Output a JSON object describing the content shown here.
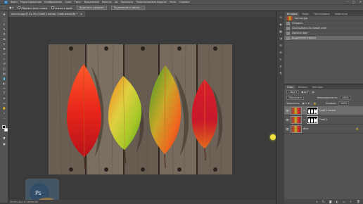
{
  "menu": {
    "items": [
      "Файл",
      "Редактирование",
      "Изображение",
      "Слои",
      "Текст",
      "Выделение",
      "Фильтр",
      "3D",
      "Просмотр",
      "Подключаемые модули",
      "Окно",
      "Справка"
    ],
    "window_controls": [
      "–",
      "□",
      "×"
    ]
  },
  "options_bar": {
    "sample_all_layers": "Образец всех слоев",
    "enhance_edge": "Усилить край",
    "select_subject": "Выделить предмет",
    "select_and_mask": "Выделение и маска..."
  },
  "document": {
    "tab_label": "листья.jpg @ 33,3% (Слой 1 копия, Слой-маска/8) *",
    "close": "×"
  },
  "status": {
    "text": "33,33%   Док: 6,74M/20,4M"
  },
  "panels": {
    "history_tabs": [
      "История",
      "Инфо",
      "Гистограмма",
      "Навигатор"
    ],
    "history_items": [
      {
        "label": "листья.jpg",
        "kind": "snapshot"
      },
      {
        "label": "Открыть",
        "kind": "step"
      },
      {
        "label": "Скопировать на новый слой",
        "kind": "step"
      },
      {
        "label": "Удалить фон",
        "kind": "step"
      },
      {
        "label": "Выделение и маска",
        "kind": "step"
      }
    ],
    "layers_tabs": [
      "Слои",
      "Каналы",
      "Контуры"
    ],
    "layers_filter": "Вид",
    "blend_mode": "Обычные",
    "opacity_label": "Непрозрачность:",
    "opacity_value": "100%",
    "lock_label": "Закрепить:",
    "fill_label": "Заливка:",
    "fill_value": "100%",
    "layers": [
      {
        "name": "Слой 1 копия",
        "active": true,
        "mask": true
      },
      {
        "name": "Слой 1",
        "active": false,
        "mask": true
      },
      {
        "name": "Фон",
        "active": false,
        "mask": false,
        "locked": true
      }
    ]
  },
  "colors": {
    "accent_cursor": "#f0e040",
    "panel_bg": "#535353",
    "canvas_bg": "#3b3b3b"
  }
}
